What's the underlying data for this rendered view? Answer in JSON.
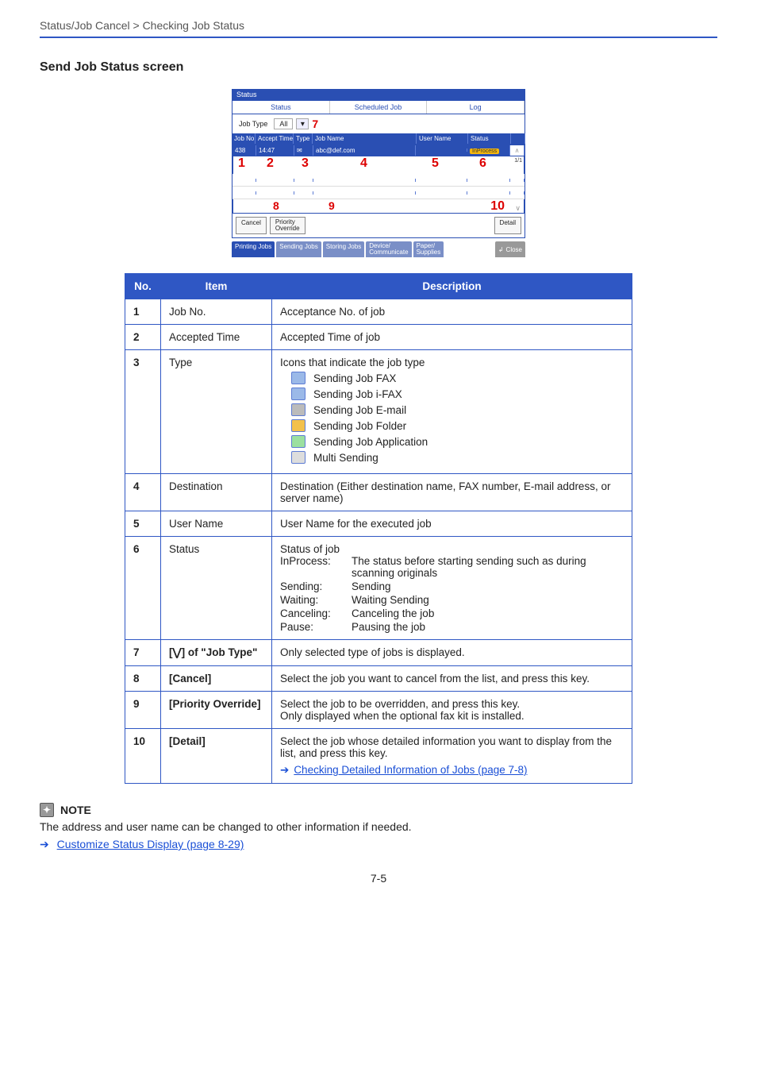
{
  "breadcrumb": "Status/Job Cancel > Checking Job Status",
  "section_title": "Send Job Status screen",
  "panel": {
    "title": "Status",
    "tabs": {
      "status": "Status",
      "scheduled": "Scheduled Job",
      "log": "Log"
    },
    "jobtype_label": "Job Type",
    "jobtype_value": "All",
    "marker7": "7",
    "headers": {
      "no": "Job No.",
      "time": "Accept Time",
      "type": "Type",
      "name": "Job Name",
      "user": "User Name",
      "status": "Status"
    },
    "row": {
      "no": "438",
      "time": "14:47",
      "name": "abc@def.com",
      "user": "",
      "status": "InProcess"
    },
    "page_indicator": "1/1",
    "markers": {
      "m1": "1",
      "m2": "2",
      "m3": "3",
      "m4": "4",
      "m5": "5",
      "m6": "6",
      "m8": "8",
      "m9": "9",
      "m10": "10"
    },
    "buttons": {
      "cancel": "Cancel",
      "priority": "Priority\nOverride",
      "detail": "Detail"
    },
    "foot": {
      "printing": "Printing Jobs",
      "sending": "Sending Jobs",
      "storing": "Storing Jobs",
      "device": "Device/\nCommunicate",
      "paper": "Paper/\nSupplies",
      "close": "Close"
    }
  },
  "table_head": {
    "no": "No.",
    "item": "Item",
    "desc": "Description"
  },
  "rows": [
    {
      "no": "1",
      "item": "Job No.",
      "desc": "Acceptance No. of job"
    },
    {
      "no": "2",
      "item": "Accepted Time",
      "desc": "Accepted Time of job"
    },
    {
      "no": "3",
      "item": "Type",
      "desc": "Icons that indicate the job type",
      "icons": [
        "Sending Job FAX",
        "Sending Job i-FAX",
        "Sending Job E-mail",
        "Sending Job Folder",
        "Sending Job Application",
        "Multi Sending"
      ]
    },
    {
      "no": "4",
      "item": "Destination",
      "desc": "Destination (Either destination name, FAX number, E-mail address, or server name)"
    },
    {
      "no": "5",
      "item": "User Name",
      "desc": "User Name for the executed job"
    },
    {
      "no": "6",
      "item": "Status",
      "desc_lead": "Status of job",
      "statuses": [
        [
          "InProcess:",
          "The status before starting sending such as during scanning originals"
        ],
        [
          "Sending:",
          "Sending"
        ],
        [
          "Waiting:",
          "Waiting Sending"
        ],
        [
          "Canceling:",
          "Canceling the job"
        ],
        [
          "Pause:",
          "Pausing the job"
        ]
      ]
    },
    {
      "no": "7",
      "item": "[⋁] of \"Job Type\"",
      "desc": "Only selected type of jobs is displayed."
    },
    {
      "no": "8",
      "item": "[Cancel]",
      "desc": "Select the job you want to cancel from the list, and press this key."
    },
    {
      "no": "9",
      "item": "[Priority Override]",
      "desc": "Select the job to be overridden, and press this key.\nOnly displayed when the optional fax kit is installed."
    },
    {
      "no": "10",
      "item": "[Detail]",
      "desc": "Select the job whose detailed information you want to display from the list, and press this key.",
      "link": "Checking Detailed Information of Jobs (page 7-8)"
    }
  ],
  "note": {
    "heading": "NOTE",
    "text": "The address and user name can be changed to other information if needed.",
    "link": "Customize Status Display (page 8-29)"
  },
  "page_number": "7-5"
}
